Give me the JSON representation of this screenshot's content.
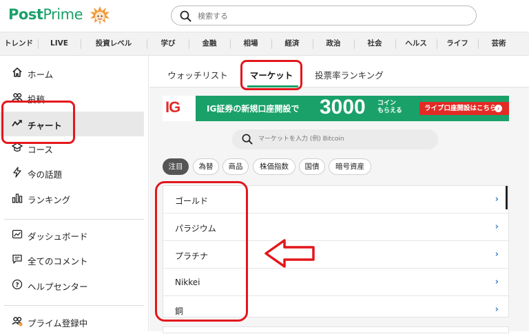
{
  "header": {
    "logo_bold": "Post",
    "logo_light": "Prime",
    "search_placeholder": "検索する"
  },
  "categories": [
    "トレンド",
    "LIVE",
    "投資レベル",
    "学び",
    "金融",
    "相場",
    "経済",
    "政治",
    "社会",
    "ヘルス",
    "ライフ",
    "芸術"
  ],
  "sidebar": {
    "items": [
      {
        "label": "ホーム",
        "icon": "home-icon"
      },
      {
        "label": "投稿",
        "icon": "users-icon"
      },
      {
        "label": "チャート",
        "icon": "chart-line-icon",
        "active": true
      },
      {
        "label": "コース",
        "icon": "graduation-cap-icon"
      },
      {
        "label": "今の話題",
        "icon": "lightning-icon"
      },
      {
        "label": "ランキング",
        "icon": "ranking-bars-icon"
      },
      {
        "label": "ダッシュボード",
        "icon": "dashboard-icon"
      },
      {
        "label": "全てのコメント",
        "icon": "comment-icon"
      },
      {
        "label": "ヘルプセンター",
        "icon": "help-icon"
      },
      {
        "label": "プライム登録中",
        "icon": "prime-users-icon"
      }
    ]
  },
  "tabs": [
    {
      "label": "ウォッチリスト"
    },
    {
      "label": "マーケット",
      "active": true
    },
    {
      "label": "投票率ランキング"
    }
  ],
  "banner": {
    "brand": "IG",
    "text": "IG証券の新規口座開設で",
    "amount": "3000",
    "coin_line1": "コイン",
    "coin_line2": "もらえる",
    "cta": "ライブ口座開設はこちら"
  },
  "market_search": {
    "placeholder": "マーケットを入力 (例) Bitcoin"
  },
  "filter_chips": [
    {
      "label": "注目",
      "active": true
    },
    {
      "label": "為替"
    },
    {
      "label": "商品"
    },
    {
      "label": "株価指数"
    },
    {
      "label": "国債"
    },
    {
      "label": "暗号資産"
    }
  ],
  "markets": [
    {
      "name": "ゴールド"
    },
    {
      "name": "パラジウム"
    },
    {
      "name": "プラチナ"
    },
    {
      "name": "Nikkei"
    },
    {
      "name": "銅"
    }
  ],
  "colors": {
    "brand_green": "#1aa169",
    "annotation_red": "#e3161b",
    "chevron_blue": "#3b82c4",
    "banner_red": "#e32b26"
  }
}
